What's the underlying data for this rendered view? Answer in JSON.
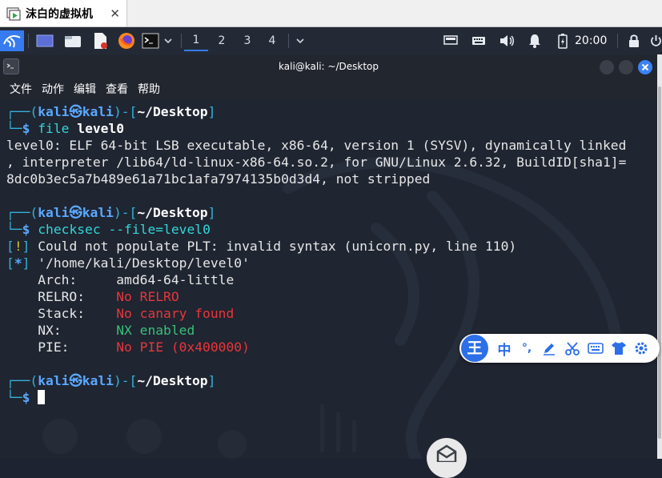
{
  "vm_tab": {
    "title": "沫白的虚拟机",
    "close": "✕"
  },
  "panel": {
    "workspaces": [
      "1",
      "2",
      "3",
      "4"
    ],
    "active_workspace": "1",
    "clock": "20:00"
  },
  "window": {
    "title": "kali@kali: ~/Desktop",
    "menu": [
      "文件",
      "动作",
      "编辑",
      "查看",
      "帮助"
    ]
  },
  "terminal": {
    "prompt1": {
      "user": "kali",
      "host": "kali",
      "dir": "~/Desktop",
      "command": "file",
      "arg": "level0"
    },
    "file_output": [
      "level0: ELF 64-bit LSB executable, x86-64, version 1 (SYSV), dynamically linked",
      ", interpreter /lib64/ld-linux-x86-64.so.2, for GNU/Linux 2.6.32, BuildID[sha1]=",
      "8dc0b3ec5a7b489e61a71bc1afa7974135b0d3d4, not stripped"
    ],
    "prompt2": {
      "user": "kali",
      "host": "kali",
      "dir": "~/Desktop",
      "command": "checksec --file=level0"
    },
    "checksec": {
      "warn_mark": "!",
      "warn_text": " Could not populate PLT: invalid syntax (unicorn.py, line 110)",
      "info_mark": "*",
      "info_text": " '/home/kali/Desktop/level0'",
      "rows": [
        {
          "key": "    Arch:     ",
          "value": "amd64-64-little",
          "status": "neutral"
        },
        {
          "key": "    RELRO:    ",
          "value": "No RELRO",
          "status": "bad"
        },
        {
          "key": "    Stack:    ",
          "value": "No canary found",
          "status": "bad"
        },
        {
          "key": "    NX:       ",
          "value": "NX enabled",
          "status": "good"
        },
        {
          "key": "    PIE:      ",
          "value": "No PIE (0x400000)",
          "status": "bad"
        }
      ]
    },
    "prompt3": {
      "user": "kali",
      "host": "kali",
      "dir": "~/Desktop"
    }
  },
  "ime": {
    "logo": "王",
    "mode": "中",
    "punct": "°,"
  },
  "colors": {
    "panel": "#242a35",
    "terminal_bg": "#1f2531",
    "prompt": "#34b2d9",
    "bad": "#e8363a",
    "good": "#38c17a",
    "accent": "#367bf0"
  }
}
